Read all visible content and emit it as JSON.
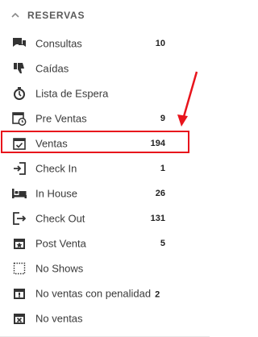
{
  "section": {
    "title": "RESERVAS",
    "icon": "chevron-up-icon"
  },
  "items": [
    {
      "label": "Consultas",
      "count": "10",
      "icon": "chat-bubbles-icon"
    },
    {
      "label": "Caídas",
      "count": "",
      "icon": "thumbs-down-icon"
    },
    {
      "label": "Lista de Espera",
      "count": "",
      "icon": "stopwatch-icon"
    },
    {
      "label": "Pre Ventas",
      "count": "9",
      "icon": "calendar-clock-icon"
    },
    {
      "label": "Ventas",
      "count": "194",
      "icon": "calendar-check-icon"
    },
    {
      "label": "Check In",
      "count": "1",
      "icon": "sign-in-icon"
    },
    {
      "label": "In House",
      "count": "26",
      "icon": "bed-icon"
    },
    {
      "label": "Check Out",
      "count": "131",
      "icon": "sign-out-icon"
    },
    {
      "label": "Post Venta",
      "count": "5",
      "icon": "calendar-star-icon"
    },
    {
      "label": "No Shows",
      "count": "",
      "icon": "dotted-square-icon"
    },
    {
      "label": "No ventas con penalidad",
      "count": "2",
      "icon": "calendar-exclamation-icon"
    },
    {
      "label": "No ventas",
      "count": "",
      "icon": "calendar-x-icon"
    }
  ],
  "colors": {
    "highlight": "#e8141c",
    "icon": "#333333"
  }
}
